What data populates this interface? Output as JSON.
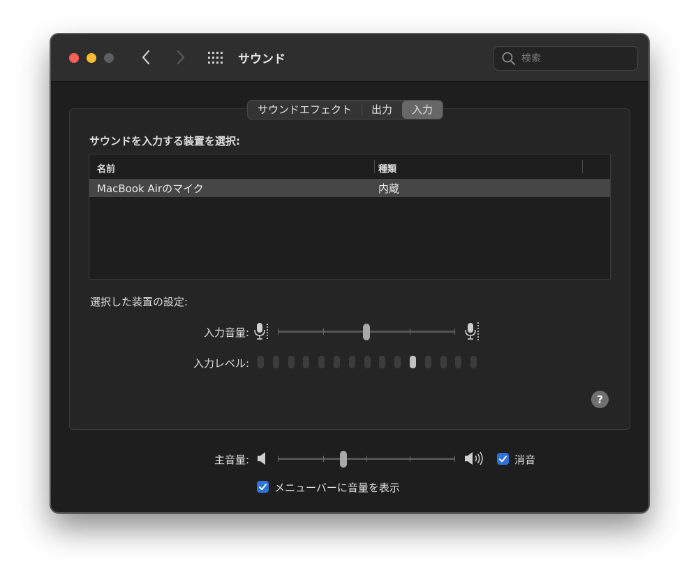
{
  "window": {
    "title": "サウンド"
  },
  "search": {
    "placeholder": "検索"
  },
  "tabs": [
    {
      "label": "サウンドエフェクト",
      "active": false
    },
    {
      "label": "出力",
      "active": false
    },
    {
      "label": "入力",
      "active": true
    }
  ],
  "input": {
    "heading": "サウンドを入力する装置を選択:",
    "columns": [
      "名前",
      "種類"
    ],
    "rows": [
      {
        "name": "MacBook Airのマイク",
        "type": "内蔵",
        "selected": true
      }
    ],
    "settings_heading": "選択した装置の設定:",
    "volume_label": "入力音量:",
    "volume_value": 0.5,
    "level_label": "入力レベル:",
    "level_count": 15,
    "level_active_index": 10
  },
  "help": {
    "label": "?"
  },
  "output": {
    "volume_label": "主音量:",
    "volume_value": 0.37,
    "mute_label": "消音",
    "mute_checked": true,
    "menubar_label": "メニューバーに音量を表示",
    "menubar_checked": true
  },
  "colors": {
    "accent": "#2e72d8",
    "close": "#ff5f57",
    "minimize": "#febc2e",
    "zoom_disabled": "#5e5e5e"
  },
  "icons": {
    "nav_back": "chevron-left-icon",
    "nav_forward": "chevron-right-icon",
    "all_prefs": "grid-icon",
    "search": "search-icon",
    "mic_low": "microphone-icon",
    "mic_high": "microphone-icon",
    "speaker_low": "speaker-icon",
    "speaker_high": "speaker-wave-icon",
    "checkmark": "checkmark-icon"
  }
}
